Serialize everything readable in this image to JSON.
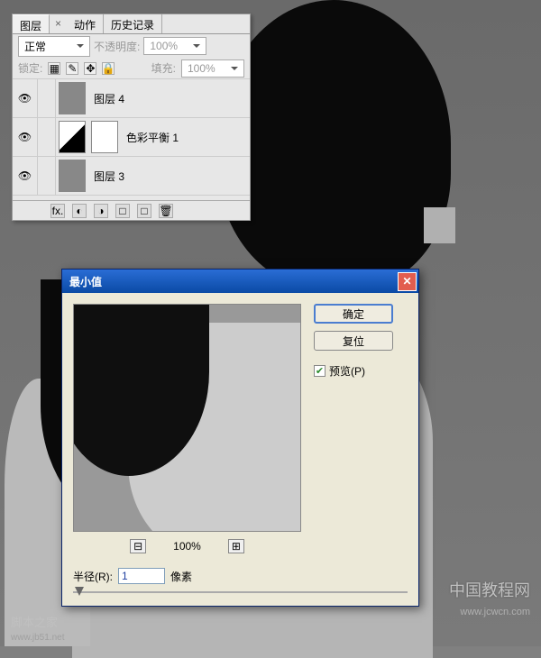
{
  "layers_panel": {
    "tabs": [
      "图层",
      "动作",
      "历史记录"
    ],
    "tab_close": "×",
    "blend_mode": "正常",
    "opacity_label": "不透明度:",
    "opacity_value": "100%",
    "lock_label": "锁定:",
    "fill_label": "填充:",
    "fill_value": "100%",
    "layers": [
      {
        "name": "图层 4"
      },
      {
        "name": "色彩平衡 1"
      },
      {
        "name": "图层 3"
      }
    ],
    "bottom_icons": [
      "fx.",
      "◐",
      "◑",
      "□",
      "□",
      "🗑"
    ]
  },
  "dialog": {
    "title": "最小值",
    "ok": "确定",
    "cancel": "复位",
    "preview_label": "预览(P)",
    "zoom_value": "100%",
    "zoom_out": "⊟",
    "zoom_in": "⊞",
    "radius_label": "半径(R):",
    "radius_value": "1",
    "radius_unit": "像素"
  },
  "watermarks": {
    "w1": "中国教程网",
    "w2": "www.jcwcn.com",
    "w3": "脚本之家",
    "w4": "www.jb51.net"
  }
}
